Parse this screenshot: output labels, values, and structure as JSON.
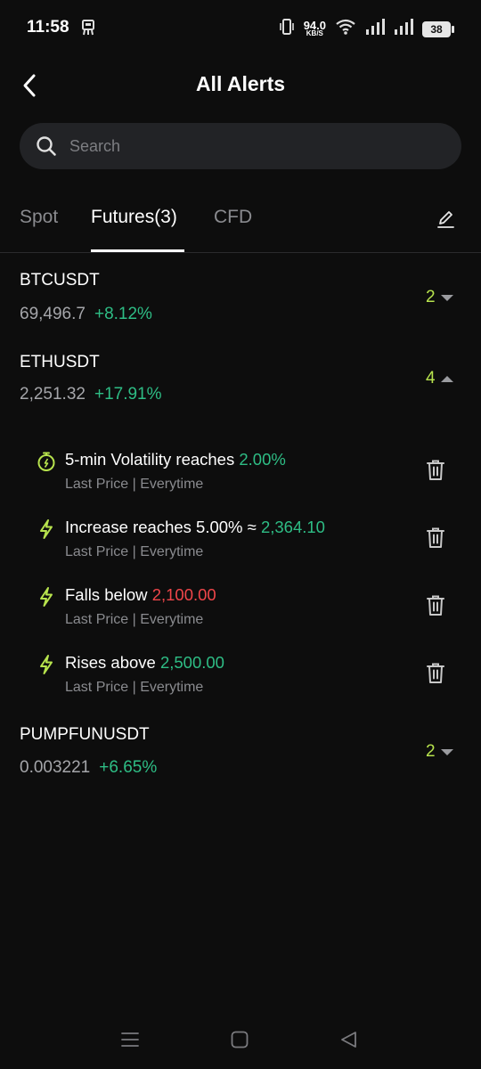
{
  "status_bar": {
    "time": "11:58",
    "net_speed_value": "94.0",
    "net_speed_unit": "KB/S",
    "battery": "38"
  },
  "header": {
    "title": "All Alerts"
  },
  "search": {
    "placeholder": "Search"
  },
  "tabs": [
    {
      "label": "Spot",
      "active": false
    },
    {
      "label": "Futures(3)",
      "active": true
    },
    {
      "label": "CFD",
      "active": false
    }
  ],
  "symbols": [
    {
      "name": "BTCUSDT",
      "price": "69,496.7",
      "change": "+8.12%",
      "count": "2",
      "expanded": false
    },
    {
      "name": "ETHUSDT",
      "price": "2,251.32",
      "change": "+17.91%",
      "count": "4",
      "expanded": true,
      "alerts": [
        {
          "icon": "stopwatch-icon",
          "text": "5-min Volatility reaches ",
          "value": "2.00%",
          "value_color": "#2ebd85",
          "sub": "Last Price | Everytime"
        },
        {
          "icon": "lightning-icon",
          "text": "Increase reaches 5.00% ≈ ",
          "value": "2,364.10",
          "value_color": "#2ebd85",
          "sub": "Last Price | Everytime"
        },
        {
          "icon": "lightning-icon",
          "text": "Falls below ",
          "value": "2,100.00",
          "value_color": "#f0464a",
          "sub": "Last Price | Everytime"
        },
        {
          "icon": "lightning-icon",
          "text": "Rises above ",
          "value": "2,500.00",
          "value_color": "#2ebd85",
          "sub": "Last Price | Everytime"
        }
      ]
    },
    {
      "name": "PUMPFUNUSDT",
      "price": "0.003221",
      "change": "+6.65%",
      "count": "2",
      "expanded": false
    }
  ],
  "colors": {
    "background": "#0d0d0d",
    "positive": "#2ebd85",
    "negative": "#f0464a",
    "count_accent": "#b7e34d",
    "muted_text": "#8a8b8f"
  }
}
